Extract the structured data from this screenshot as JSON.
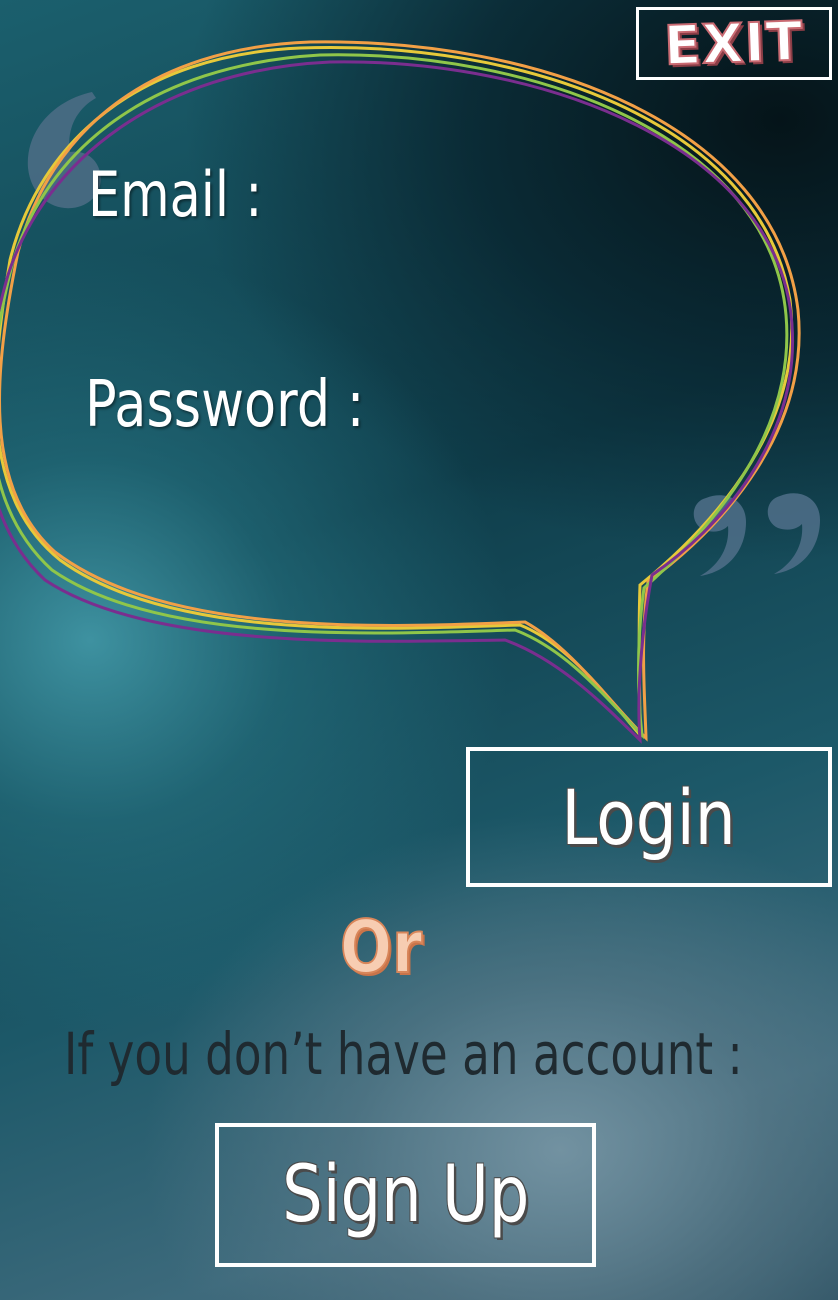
{
  "header": {
    "exit_label": "EXIT"
  },
  "form": {
    "email_label": "Email :",
    "password_label": "Password :"
  },
  "actions": {
    "login_label": "Login",
    "or_text": "Or",
    "account_prompt": "If you don’t have an account :",
    "signup_label": "Sign Up"
  },
  "colors": {
    "bubble_orange": "#f2a046",
    "bubble_green": "#8fc64a",
    "bubble_purple": "#7a2e8f",
    "bubble_yellow": "#e6c93a",
    "exit_accent": "#c96a72",
    "or_accent": "#d9865a",
    "quote_marks": "#4d6d86"
  },
  "icons": {
    "speech_bubble": "speech-bubble-icon",
    "open_quote": "open-quote-icon",
    "close_quote": "close-quote-icon"
  }
}
